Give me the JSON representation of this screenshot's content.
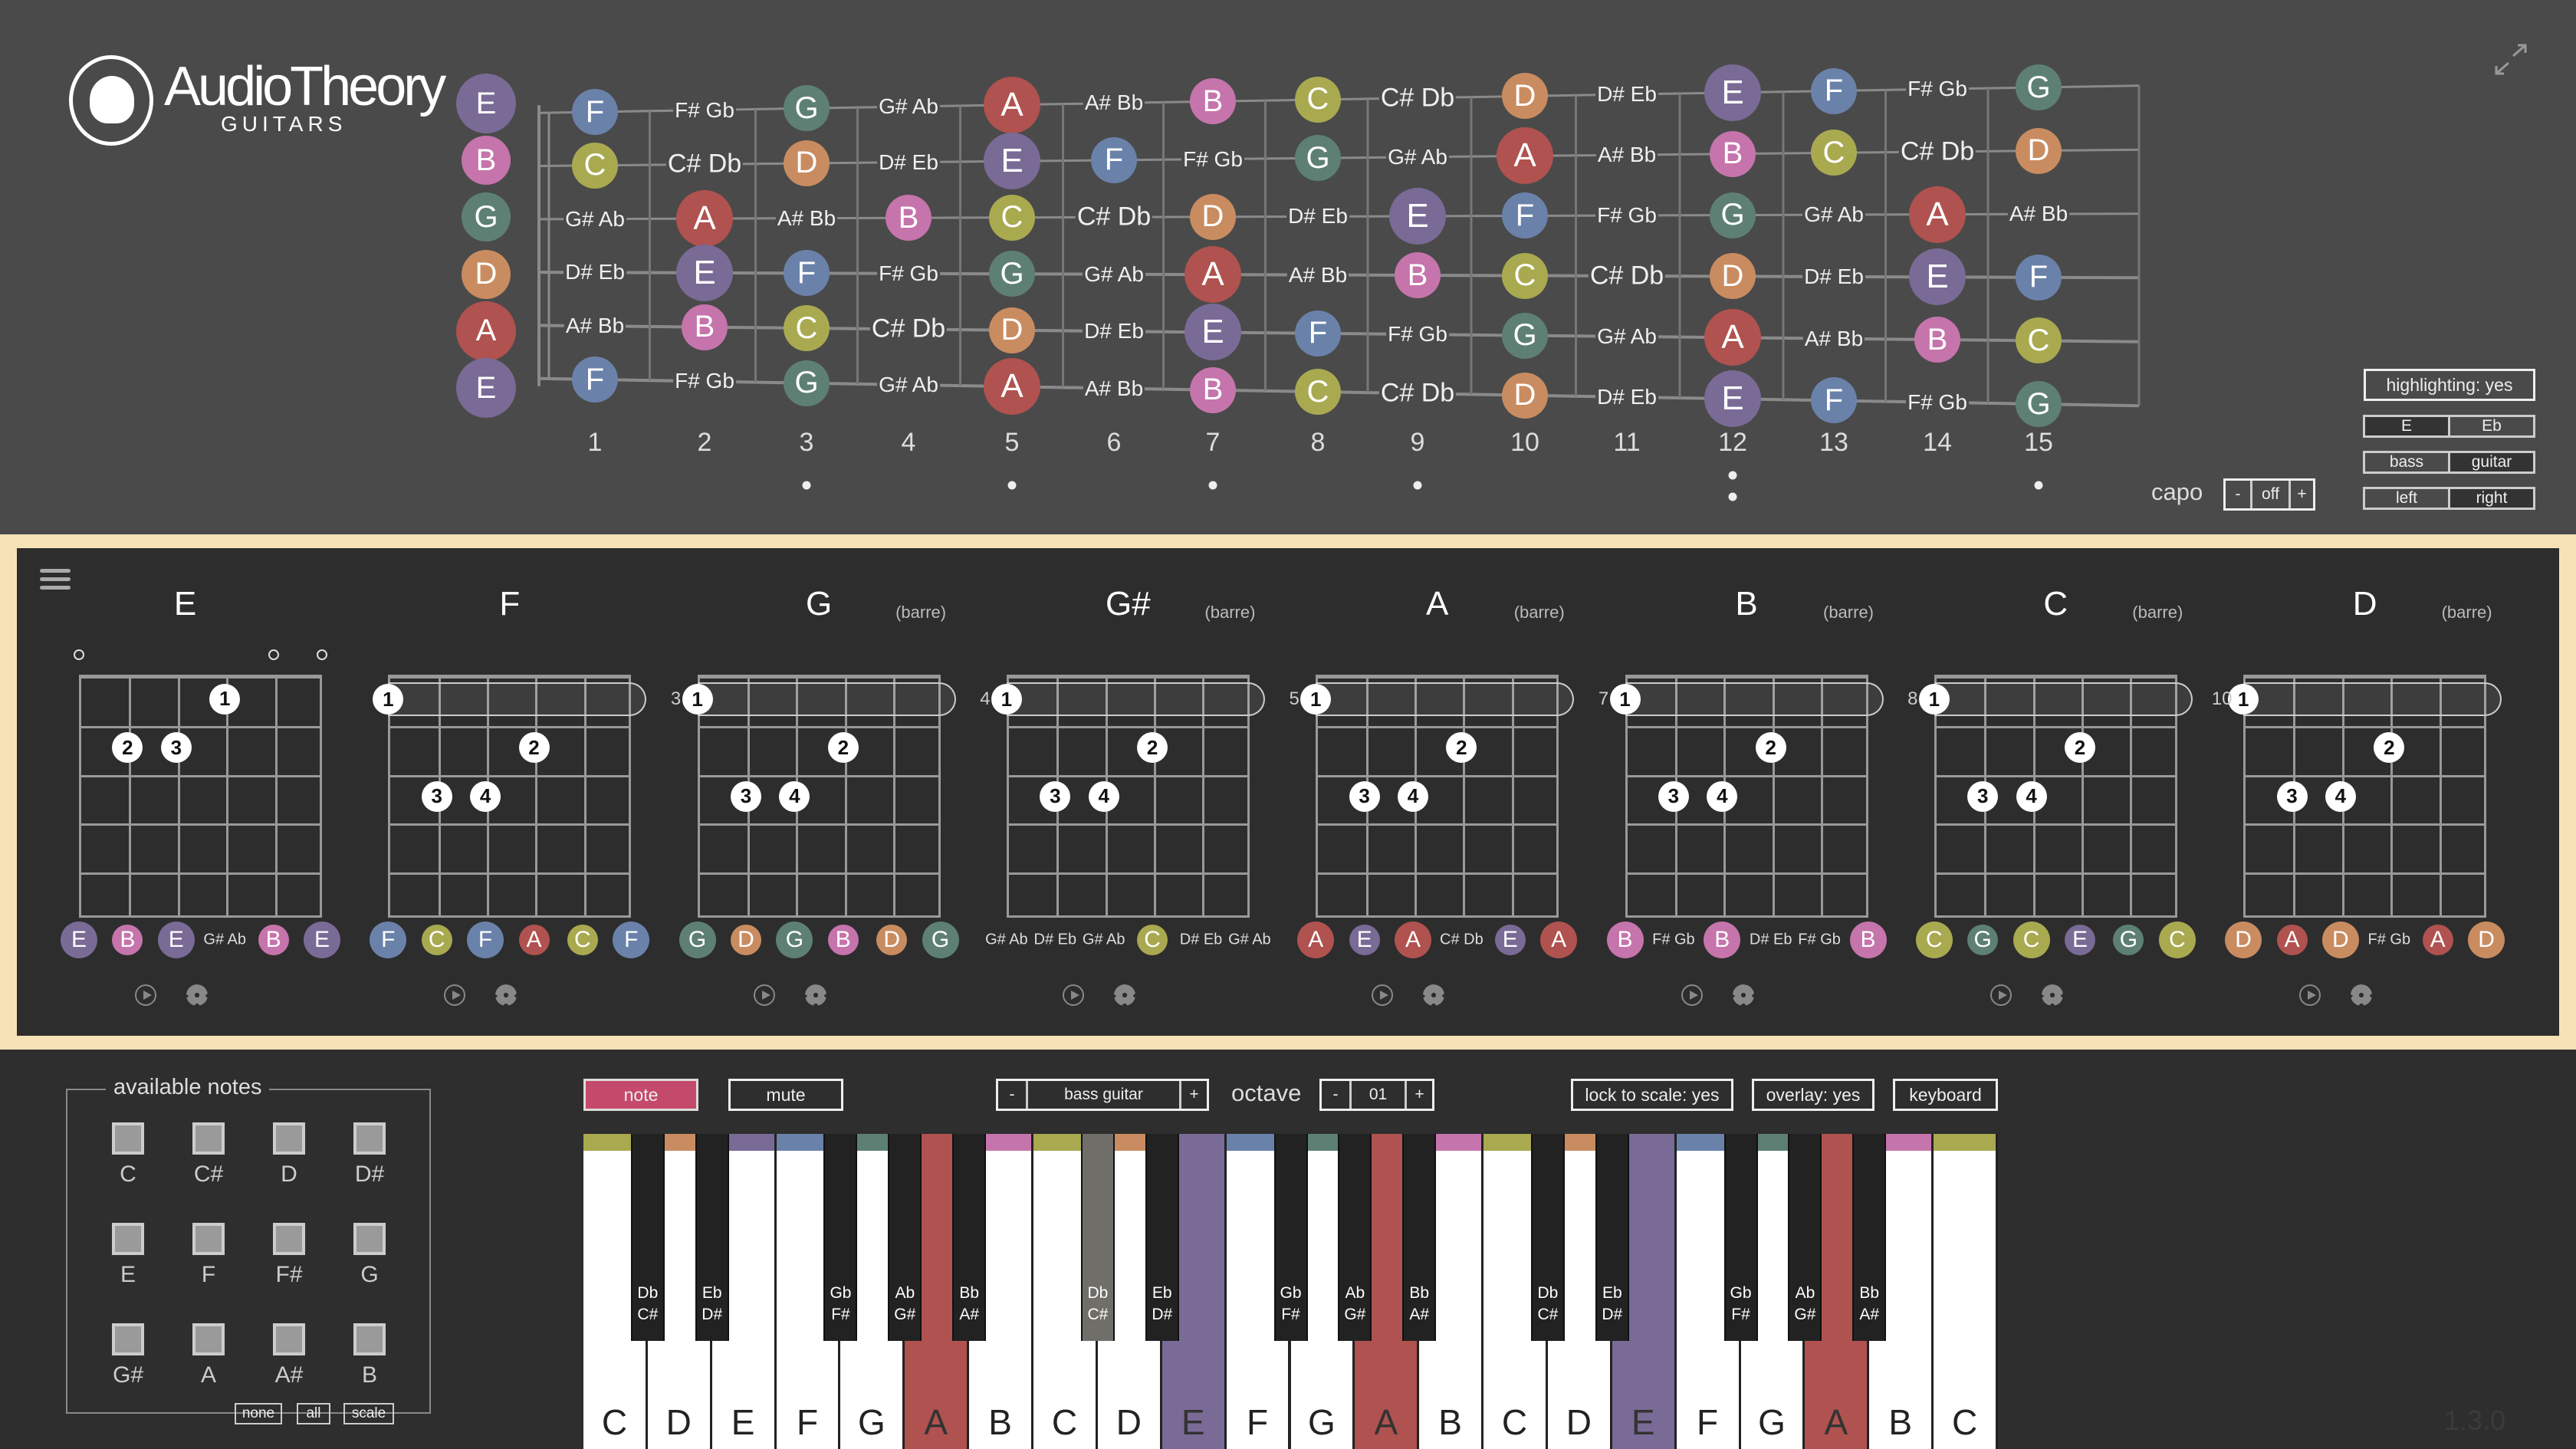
{
  "app": {
    "logo_main": "AudioTheory",
    "logo_sub": "GUITARS",
    "version": "1.3.0"
  },
  "note_colors": {
    "C": "#a9a950",
    "D": "#c98c60",
    "E": "#7a6a96",
    "F": "#6a82aa",
    "G": "#5e8074",
    "A": "#b0524f",
    "B": "#c674ac",
    "C# Db": "#6f6e69"
  },
  "fretboard": {
    "open_strings": [
      "E",
      "B",
      "G",
      "D",
      "A",
      "E"
    ],
    "fret_numbers": [
      "1",
      "2",
      "3",
      "4",
      "5",
      "6",
      "7",
      "8",
      "9",
      "10",
      "11",
      "12",
      "13",
      "14",
      "15"
    ],
    "inlay_frets": [
      3,
      5,
      7,
      9,
      12,
      15
    ],
    "notes": [
      [
        "F",
        "F# Gb",
        "G",
        "G# Ab",
        "A",
        "A# Bb",
        "B",
        "C",
        "C# Db",
        "D",
        "D# Eb",
        "E",
        "F",
        "F# Gb",
        "G"
      ],
      [
        "C",
        "C# Db",
        "D",
        "D# Eb",
        "E",
        "F",
        "F# Gb",
        "G",
        "G# Ab",
        "A",
        "A# Bb",
        "B",
        "C",
        "C# Db",
        "D"
      ],
      [
        "G# Ab",
        "A",
        "A# Bb",
        "B",
        "C",
        "C# Db",
        "D",
        "D# Eb",
        "E",
        "F",
        "F# Gb",
        "G",
        "G# Ab",
        "A",
        "A# Bb"
      ],
      [
        "D# Eb",
        "E",
        "F",
        "F# Gb",
        "G",
        "G# Ab",
        "A",
        "A# Bb",
        "B",
        "C",
        "C# Db",
        "D",
        "D# Eb",
        "E",
        "F"
      ],
      [
        "A# Bb",
        "B",
        "C",
        "C# Db",
        "D",
        "D# Eb",
        "E",
        "F",
        "F# Gb",
        "G",
        "G# Ab",
        "A",
        "A# Bb",
        "B",
        "C"
      ],
      [
        "F",
        "F# Gb",
        "G",
        "G# Ab",
        "A",
        "A# Bb",
        "B",
        "C",
        "C# Db",
        "D",
        "D# Eb",
        "E",
        "F",
        "F# Gb",
        "G"
      ]
    ]
  },
  "settings": {
    "highlighting": "highlighting: yes",
    "tuning": {
      "options": [
        "E",
        "Eb"
      ],
      "selected": "E"
    },
    "instrument": {
      "options": [
        "bass",
        "guitar"
      ],
      "selected": "guitar"
    },
    "hand": {
      "options": [
        "left",
        "right"
      ],
      "selected": "right"
    },
    "capo": {
      "label": "capo",
      "minus": "-",
      "value": "off",
      "plus": "+"
    }
  },
  "chords": [
    {
      "name": "E",
      "barre_label": "",
      "start_fret": "",
      "open": [
        0,
        4,
        5
      ],
      "barre": false,
      "fingers": [
        {
          "n": "1",
          "s": 3,
          "f": 1
        },
        {
          "n": "2",
          "s": 1,
          "f": 2
        },
        {
          "n": "3",
          "s": 2,
          "f": 2
        }
      ],
      "notes": [
        "E",
        "B",
        "E",
        "G# Ab",
        "B",
        "E"
      ]
    },
    {
      "name": "F",
      "barre_label": "",
      "start_fret": "",
      "open": [],
      "barre": true,
      "fingers": [
        {
          "n": "2",
          "s": 3,
          "f": 2
        },
        {
          "n": "3",
          "s": 1,
          "f": 3
        },
        {
          "n": "4",
          "s": 2,
          "f": 3
        }
      ],
      "notes": [
        "F",
        "C",
        "F",
        "A",
        "C",
        "F"
      ]
    },
    {
      "name": "G",
      "barre_label": "(barre)",
      "start_fret": "3",
      "open": [],
      "barre": true,
      "fingers": [
        {
          "n": "2",
          "s": 3,
          "f": 2
        },
        {
          "n": "3",
          "s": 1,
          "f": 3
        },
        {
          "n": "4",
          "s": 2,
          "f": 3
        }
      ],
      "notes": [
        "G",
        "D",
        "G",
        "B",
        "D",
        "G"
      ]
    },
    {
      "name": "G#",
      "barre_label": "(barre)",
      "start_fret": "4",
      "open": [],
      "barre": true,
      "fingers": [
        {
          "n": "2",
          "s": 3,
          "f": 2
        },
        {
          "n": "3",
          "s": 1,
          "f": 3
        },
        {
          "n": "4",
          "s": 2,
          "f": 3
        }
      ],
      "notes": [
        "G# Ab",
        "D# Eb",
        "G# Ab",
        "C",
        "D# Eb",
        "G# Ab"
      ]
    },
    {
      "name": "A",
      "barre_label": "(barre)",
      "start_fret": "5",
      "open": [],
      "barre": true,
      "fingers": [
        {
          "n": "2",
          "s": 3,
          "f": 2
        },
        {
          "n": "3",
          "s": 1,
          "f": 3
        },
        {
          "n": "4",
          "s": 2,
          "f": 3
        }
      ],
      "notes": [
        "A",
        "E",
        "A",
        "C# Db",
        "E",
        "A"
      ]
    },
    {
      "name": "B",
      "barre_label": "(barre)",
      "start_fret": "7",
      "open": [],
      "barre": true,
      "fingers": [
        {
          "n": "2",
          "s": 3,
          "f": 2
        },
        {
          "n": "3",
          "s": 1,
          "f": 3
        },
        {
          "n": "4",
          "s": 2,
          "f": 3
        }
      ],
      "notes": [
        "B",
        "F# Gb",
        "B",
        "D# Eb",
        "F# Gb",
        "B"
      ]
    },
    {
      "name": "C",
      "barre_label": "(barre)",
      "start_fret": "8",
      "open": [],
      "barre": true,
      "fingers": [
        {
          "n": "2",
          "s": 3,
          "f": 2
        },
        {
          "n": "3",
          "s": 1,
          "f": 3
        },
        {
          "n": "4",
          "s": 2,
          "f": 3
        }
      ],
      "notes": [
        "C",
        "G",
        "C",
        "E",
        "G",
        "C"
      ]
    },
    {
      "name": "D",
      "barre_label": "(barre)",
      "start_fret": "10",
      "open": [],
      "barre": true,
      "fingers": [
        {
          "n": "2",
          "s": 3,
          "f": 2
        },
        {
          "n": "3",
          "s": 1,
          "f": 3
        },
        {
          "n": "4",
          "s": 2,
          "f": 3
        }
      ],
      "notes": [
        "D",
        "A",
        "D",
        "F# Gb",
        "A",
        "D"
      ]
    }
  ],
  "barre_finger": "1",
  "available_notes": {
    "title": "available notes",
    "notes": [
      "C",
      "C#",
      "D",
      "D#",
      "E",
      "F",
      "F#",
      "G",
      "G#",
      "A",
      "A#",
      "B"
    ],
    "buttons": [
      "none",
      "all",
      "scale"
    ]
  },
  "toolbar": {
    "note": "note",
    "mute": "mute",
    "instrument_minus": "-",
    "instrument": "bass guitar",
    "instrument_plus": "+",
    "octave_label": "octave",
    "octave_minus": "-",
    "octave": "01",
    "octave_plus": "+",
    "lock": "lock to scale: yes",
    "overlay": "overlay: yes",
    "keyboard": "keyboard",
    "note_active_color": "#c5496b"
  },
  "keyboard": {
    "white_keys": [
      "C",
      "D",
      "E",
      "F",
      "G",
      "A",
      "B",
      "C",
      "D",
      "E",
      "F",
      "G",
      "A",
      "B",
      "C",
      "D",
      "E",
      "F",
      "G",
      "A",
      "B",
      "C"
    ],
    "highlighted_white": [
      5,
      9,
      12,
      16,
      19
    ],
    "black_keys": [
      [
        "Db",
        "C#"
      ],
      [
        "Eb",
        "D#"
      ],
      [
        "Gb",
        "F#"
      ],
      [
        "Ab",
        "G#"
      ],
      [
        "Bb",
        "A#"
      ],
      [
        "Db",
        "C#"
      ],
      [
        "Eb",
        "D#"
      ],
      [
        "Gb",
        "F#"
      ],
      [
        "Ab",
        "G#"
      ],
      [
        "Bb",
        "A#"
      ],
      [
        "Db",
        "C#"
      ],
      [
        "Eb",
        "D#"
      ],
      [
        "Gb",
        "F#"
      ],
      [
        "Ab",
        "G#"
      ],
      [
        "Bb",
        "A#"
      ]
    ],
    "highlighted_black": [
      5
    ]
  }
}
